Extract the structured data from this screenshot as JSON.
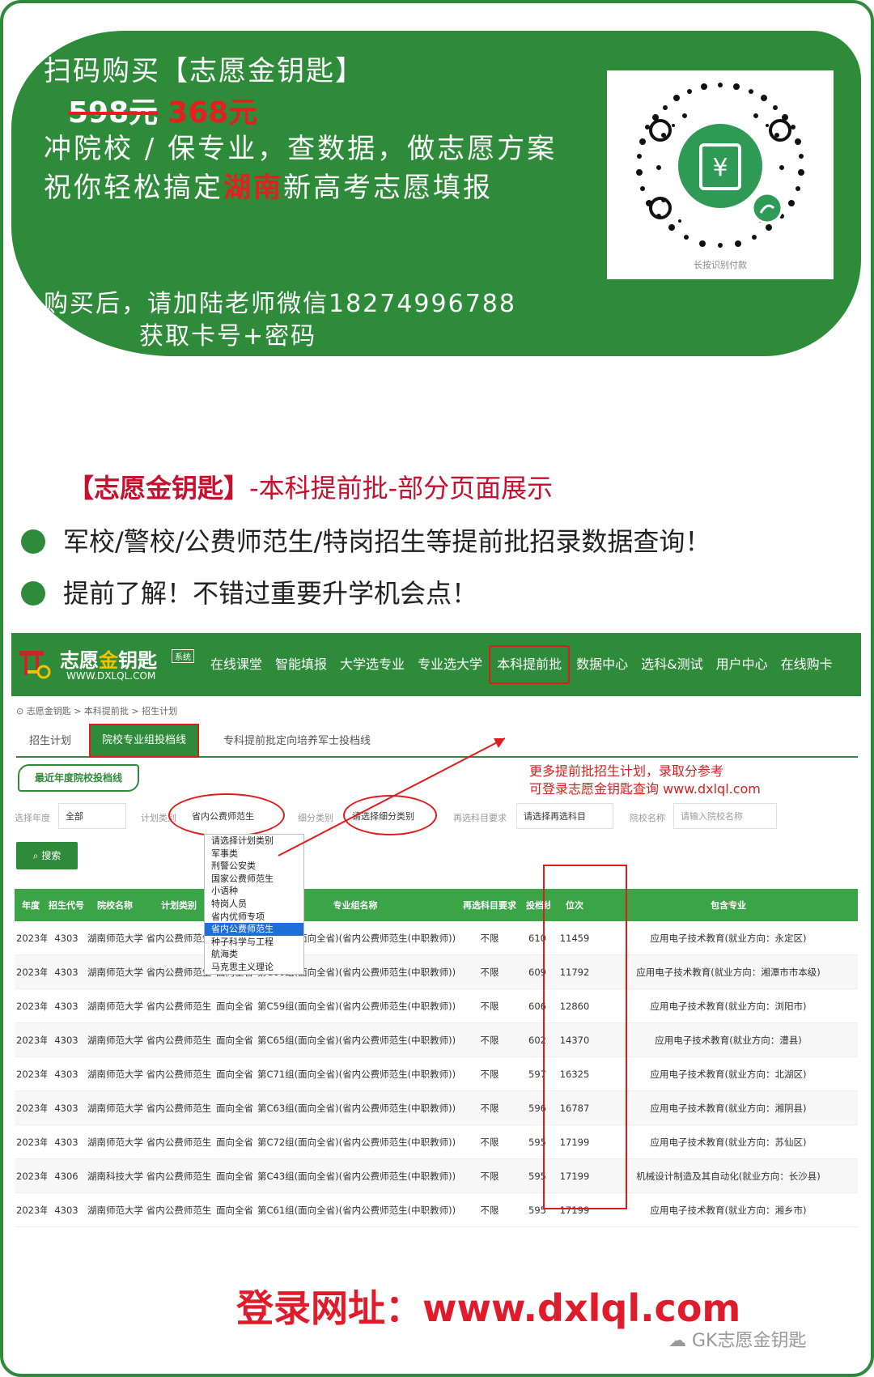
{
  "promo": {
    "title": "扫码购买【志愿金钥匙】",
    "old_price": "598元",
    "new_price": "368元",
    "line3": "冲院校 / 保专业，查数据，做志愿方案",
    "line4_pre": "祝你轻松搞定",
    "line4_hl": "湖南",
    "line4_post": "新高考志愿填报",
    "contact": "购买后，请加陆老师微信18274996788",
    "contact2": "获取卡号+密码",
    "qr_caption": "长按识别付款"
  },
  "intro": {
    "title_bold": "【志愿金钥匙】",
    "title_rest": "-本科提前批-部分页面展示",
    "bullet1": "军校/警校/公费师范生/特岗招生等提前批招录数据查询！",
    "bullet2": "提前了解！不错过重要升学机会点！"
  },
  "site": {
    "logo_name_a": "志愿",
    "logo_name_b": "金",
    "logo_name_c": "钥匙",
    "logo_tag": "系统",
    "logo_url": "WWW.DXLQL.COM",
    "menu": [
      "在线课堂",
      "智能填报",
      "大学选专业",
      "专业选大学",
      "本科提前批",
      "数据中心",
      "选科&测试",
      "用户中心",
      "在线购卡"
    ],
    "breadcrumb": "志愿金钥匙 > 本科提前批 > 招生计划",
    "tabs": [
      "招生计划",
      "院校专业组投档线",
      "专科提前批定向培养军士投档线"
    ],
    "sub_badge": "最近年度院校投档线",
    "note_line1": "更多提前批招生计划，录取分参考",
    "note_line2": "可登录志愿金钥匙查询 www.dxlql.com",
    "filters": {
      "year_label": "选择年度",
      "year_value": "全部",
      "plan_label": "计划类别",
      "plan_value": "省内公费师范生",
      "sub_label": "细分类别",
      "sub_value": "请选择细分类别",
      "subject_label": "再选科目要求",
      "subject_value": "请选择再选科目",
      "school_label": "院校名称",
      "school_placeholder": "请输入院校名称"
    },
    "search_label": "搜索",
    "dropdown_options": [
      "请选择计划类别",
      "军事类",
      "刑警公安类",
      "国家公费师范生",
      "小语种",
      "特岗人员",
      "省内优师专项",
      "省内公费师范生",
      "种子科学与工程",
      "航海类",
      "马克思主义理论"
    ],
    "dropdown_selected": 7,
    "table_headers": [
      "年度",
      "招生代号",
      "院校名称",
      "计划类别",
      "",
      "专业组名称",
      "再选科目要求",
      "投档线",
      "位次",
      "包含专业"
    ],
    "rows": [
      [
        "2023年",
        "4303",
        "湖南师范大学",
        "省内公费师范生",
        "面向全省",
        "第C56组(面向全省)(省内公费师范生(中职教师))",
        "不限",
        "610",
        "11459",
        "应用电子技术教育(就业方向：永定区)"
      ],
      [
        "2023年",
        "4303",
        "湖南师范大学",
        "省内公费师范生",
        "面向全省",
        "第C60组(面向全省)(省内公费师范生(中职教师))",
        "不限",
        "609",
        "11792",
        "应用电子技术教育(就业方向：湘潭市市本级)"
      ],
      [
        "2023年",
        "4303",
        "湖南师范大学",
        "省内公费师范生",
        "面向全省",
        "第C59组(面向全省)(省内公费师范生(中职教师))",
        "不限",
        "606",
        "12860",
        "应用电子技术教育(就业方向：浏阳市)"
      ],
      [
        "2023年",
        "4303",
        "湖南师范大学",
        "省内公费师范生",
        "面向全省",
        "第C65组(面向全省)(省内公费师范生(中职教师))",
        "不限",
        "602",
        "14370",
        "应用电子技术教育(就业方向：澧县)"
      ],
      [
        "2023年",
        "4303",
        "湖南师范大学",
        "省内公费师范生",
        "面向全省",
        "第C71组(面向全省)(省内公费师范生(中职教师))",
        "不限",
        "597",
        "16325",
        "应用电子技术教育(就业方向：北湖区)"
      ],
      [
        "2023年",
        "4303",
        "湖南师范大学",
        "省内公费师范生",
        "面向全省",
        "第C63组(面向全省)(省内公费师范生(中职教师))",
        "不限",
        "596",
        "16787",
        "应用电子技术教育(就业方向：湘阴县)"
      ],
      [
        "2023年",
        "4303",
        "湖南师范大学",
        "省内公费师范生",
        "面向全省",
        "第C72组(面向全省)(省内公费师范生(中职教师))",
        "不限",
        "595",
        "17199",
        "应用电子技术教育(就业方向：苏仙区)"
      ],
      [
        "2023年",
        "4306",
        "湖南科技大学",
        "省内公费师范生",
        "面向全省",
        "第C43组(面向全省)(省内公费师范生(中职教师))",
        "不限",
        "595",
        "17199",
        "机械设计制造及其自动化(就业方向：长沙县)"
      ],
      [
        "2023年",
        "4303",
        "湖南师范大学",
        "省内公费师范生",
        "面向全省",
        "第C61组(面向全省)(省内公费师范生(中职教师))",
        "不限",
        "595",
        "17199",
        "应用电子技术教育(就业方向：湘乡市)"
      ]
    ]
  },
  "footer": {
    "login": "登录网址：www.dxlql.com",
    "watermark": "GK志愿金钥匙"
  },
  "colors": {
    "brand_green": "#2e8b3a",
    "accent_red": "#e01b1b",
    "gold": "#f2c300"
  }
}
